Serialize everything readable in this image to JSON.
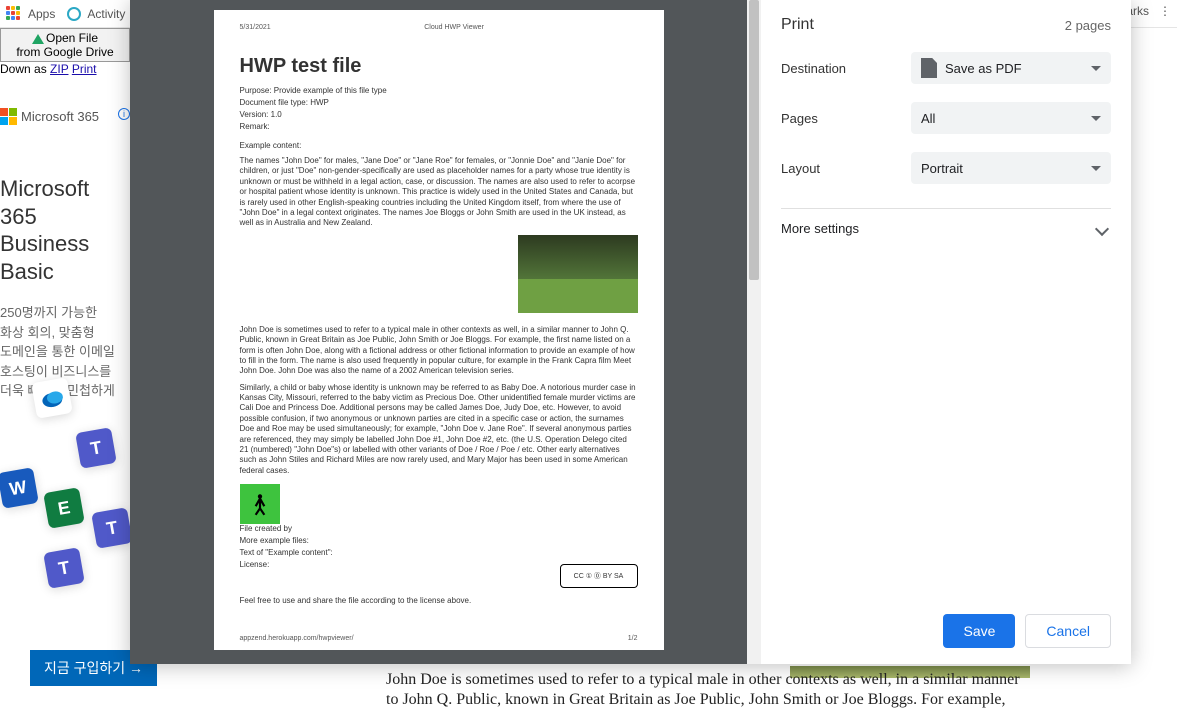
{
  "bookmarks": {
    "apps": "Apps",
    "activity": "Activity"
  },
  "right_bookmarks": "arks",
  "left": {
    "open_l1": "Open File",
    "open_l2": "from Google Drive",
    "zip_prefix": "Down as ",
    "zip": "ZIP",
    "print": "Print"
  },
  "ad": {
    "brand": "Microsoft 365",
    "headline": "Microsoft 365 Business Basic",
    "desc": "250명까지 가능한\n화상 회의, 맞춤형\n도메인을 통한 이메일\n호스팅이 비즈니스를\n더욱 빠르고 민첩하게",
    "cta": "지금 구입하기 →",
    "info": "i"
  },
  "print": {
    "title": "Print",
    "pages_count": "2 pages",
    "dest_label": "Destination",
    "dest_value": "Save as PDF",
    "pages_label": "Pages",
    "pages_value": "All",
    "layout_label": "Layout",
    "layout_value": "Portrait",
    "more": "More settings",
    "save": "Save",
    "cancel": "Cancel"
  },
  "sheet": {
    "date": "5/31/2021",
    "app": "Cloud HWP Viewer",
    "title": "HWP test file",
    "purpose": "Purpose: Provide example of this file type",
    "doctype": "Document file type: HWP",
    "version": "Version: 1.0",
    "remark": "Remark:",
    "ex_hdr": "Example content:",
    "para1": "The names \"John Doe\" for males, \"Jane Doe\" or \"Jane Roe\"  for females, or \"Jonnie Doe\" and \"Janie Doe\" for children, or just \"Doe\" non-gender-specifically are used as placeholder names for a party whose true identity is unknown or must be withheld in a legal action, case, or discussion. The names are also used to refer to acorpse or hospital patient whose identity is unknown. This practice is widely used in the United States and Canada, but is rarely used in other English-speaking countries including the United Kingdom itself, from where the use of \"John Doe\" in a legal context originates. The names Joe Bloggs or John Smith are used in the UK instead, as well as in Australia and New Zealand.",
    "para2": "John Doe is sometimes used to refer to a typical male in other contexts as well, in a similar manner to John Q. Public, known in Great Britain as Joe Public, John Smith or Joe Bloggs. For example, the first name listed on a form is often John Doe, along with a fictional address or other fictional information to provide an example of how to fill in the form. The name is also used frequently in popular culture, for example in the Frank Capra film Meet John Doe. John Doe was also the name of a 2002 American television series.",
    "para3": "Similarly, a child or baby whose identity is unknown may be referred to as Baby Doe. A notorious murder case in Kansas City, Missouri, referred to the baby victim as Precious Doe. Other unidentified female murder victims are Cali Doe and Princess Doe. Additional persons may be called James Doe, Judy Doe, etc. However, to avoid possible confusion, if two anonymous or unknown parties are cited in a specific case or action, the surnames Doe and Roe may be used simultaneously; for example, \"John Doe v. Jane Roe\". If several anonymous parties are referenced, they may simply be labelled John Doe #1, John Doe #2, etc. (the U.S. Operation Delego cited 21 (numbered) \"John Doe\"s) or labelled with other variants of Doe / Roe / Poe / etc. Other early alternatives such as John Stiles and Richard Miles are now rarely used, and Mary Major has been used in some American federal cases.",
    "file_created": "File created by",
    "more_ex": "More example files:",
    "text_of": "Text of \"Example content\":",
    "license": "License:",
    "cc": "CC  ①  ⓪\n      BY   SA",
    "feel": "Feel free to use and share the file according to the license above.",
    "footer_url": "appzend.herokuapp.com/hwpviewer/",
    "footer_pg": "1/2"
  },
  "underpage": "John Doe is sometimes used to refer to a typical male in other contexts as well, in a similar manner to John Q. Public, known in Great Britain as Joe Public, John Smith or Joe Bloggs. For example,"
}
